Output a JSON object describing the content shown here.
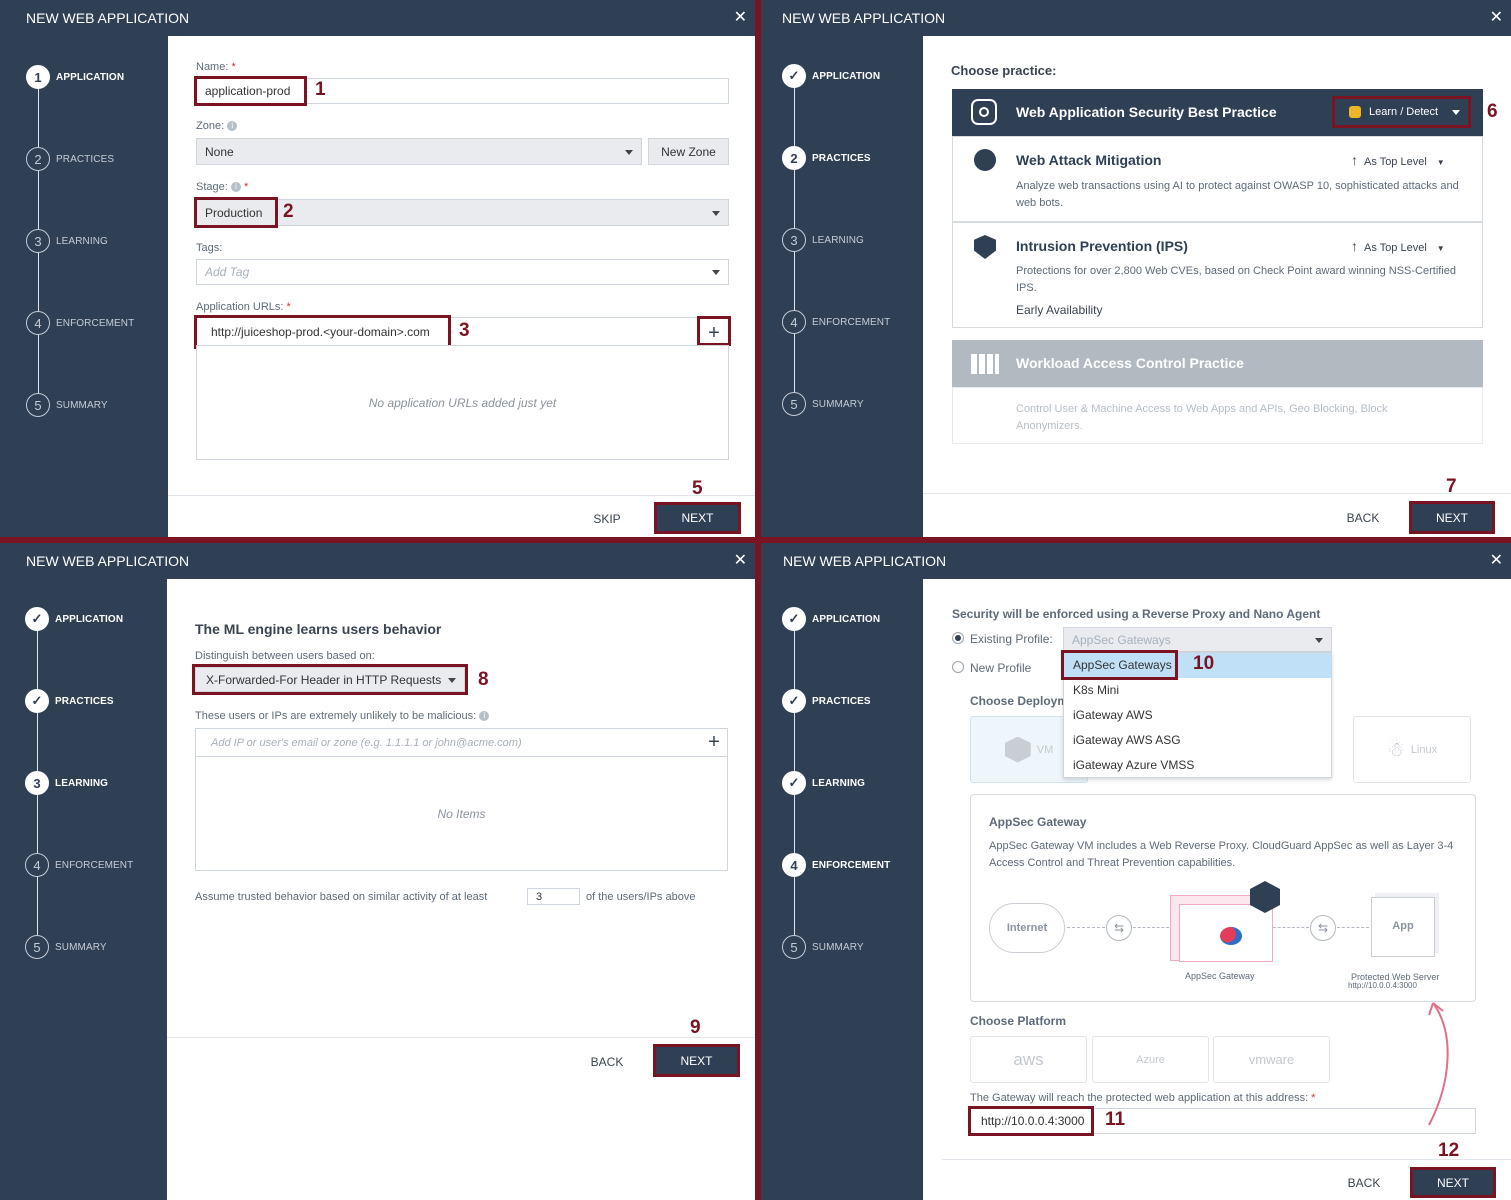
{
  "dialog_title": "NEW WEB APPLICATION",
  "close_glyph": "✕",
  "steps": [
    "APPLICATION",
    "PRACTICES",
    "LEARNING",
    "ENFORCEMENT",
    "SUMMARY"
  ],
  "step_numbers": [
    "1",
    "2",
    "3",
    "4",
    "5"
  ],
  "check_glyph": "✓",
  "buttons": {
    "skip": "SKIP",
    "back": "BACK",
    "next": "NEXT"
  },
  "annotation_color": "#7a1422",
  "annotations": [
    "1",
    "2",
    "3",
    "4",
    "5",
    "6",
    "7",
    "8",
    "9",
    "10",
    "11",
    "12"
  ],
  "application": {
    "name_label": "Name:",
    "name_value": "application-prod",
    "zone_label": "Zone:",
    "zone_value": "None",
    "new_zone_button": "New Zone",
    "stage_label": "Stage:",
    "stage_value": "Production",
    "tags_label": "Tags:",
    "tags_placeholder": "Add Tag",
    "urls_label": "Application URLs:",
    "url_value": "http://juiceshop-prod.<your-domain>.com",
    "urls_empty": "No application URLs added just yet"
  },
  "practices": {
    "choose_label": "Choose practice:",
    "main_title": "Web Application Security Best Practice",
    "main_mode": "Learn / Detect",
    "items": [
      {
        "title": "Web Attack Mitigation",
        "level": "As Top Level",
        "desc": "Analyze web transactions using AI to protect against OWASP 10, sophisticated attacks and web bots."
      },
      {
        "title": "Intrusion Prevention (IPS)",
        "level": "As Top Level",
        "desc": "Protections for over 2,800 Web CVEs, based on Check Point award winning NSS-Certified IPS.",
        "note": "Early Availability"
      }
    ],
    "workload_title": "Workload Access Control Practice",
    "workload_desc": "Control User & Machine Access to Web Apps and APIs, Geo Blocking, Block Anonymizers."
  },
  "learning": {
    "heading": "The ML engine learns users behavior",
    "distinguish_label": "Distinguish between users based on:",
    "distinguish_value": "X-Forwarded-For Header in HTTP Requests",
    "unlikely_label": "These users or IPs are extremely unlikely to be malicious:",
    "add_placeholder": "Add IP or user's email or zone (e.g. 1.1.1.1 or john@acme.com)",
    "empty": "No Items",
    "assume_prefix": "Assume trusted behavior based on similar activity of at least",
    "assume_value": "3",
    "assume_suffix": "of the users/IPs above"
  },
  "enforcement": {
    "heading": "Security will be enforced using a Reverse Proxy and Nano Agent",
    "existing_profile_label": "Existing Profile:",
    "new_profile_label": "New Profile",
    "profile_value": "AppSec Gateways",
    "dropdown_options": [
      "AppSec Gateways",
      "K8s Mini",
      "iGateway AWS",
      "iGateway AWS ASG",
      "iGateway Azure VMSS"
    ],
    "choose_deploy_label": "Choose Deploym",
    "deploy_tiles": [
      "VM",
      "Linux"
    ],
    "gateway_title": "AppSec Gateway",
    "gateway_desc": "AppSec Gateway VM includes a Web Reverse Proxy. CloudGuard AppSec as well as Layer 3-4 Access Control and Threat Prevention capabilities.",
    "diagram": {
      "internet": "Internet",
      "gateway": "AppSec Gateway",
      "app": "App",
      "server_label": "Protected Web Server",
      "server_address": "http://10.0.0.4:3000"
    },
    "choose_platform_label": "Choose Platform",
    "platforms": [
      "aws",
      "Azure",
      "vmware"
    ],
    "address_label": "The Gateway will reach the protected web application at this address:",
    "address_value": "http://10.0.0.4:3000"
  }
}
